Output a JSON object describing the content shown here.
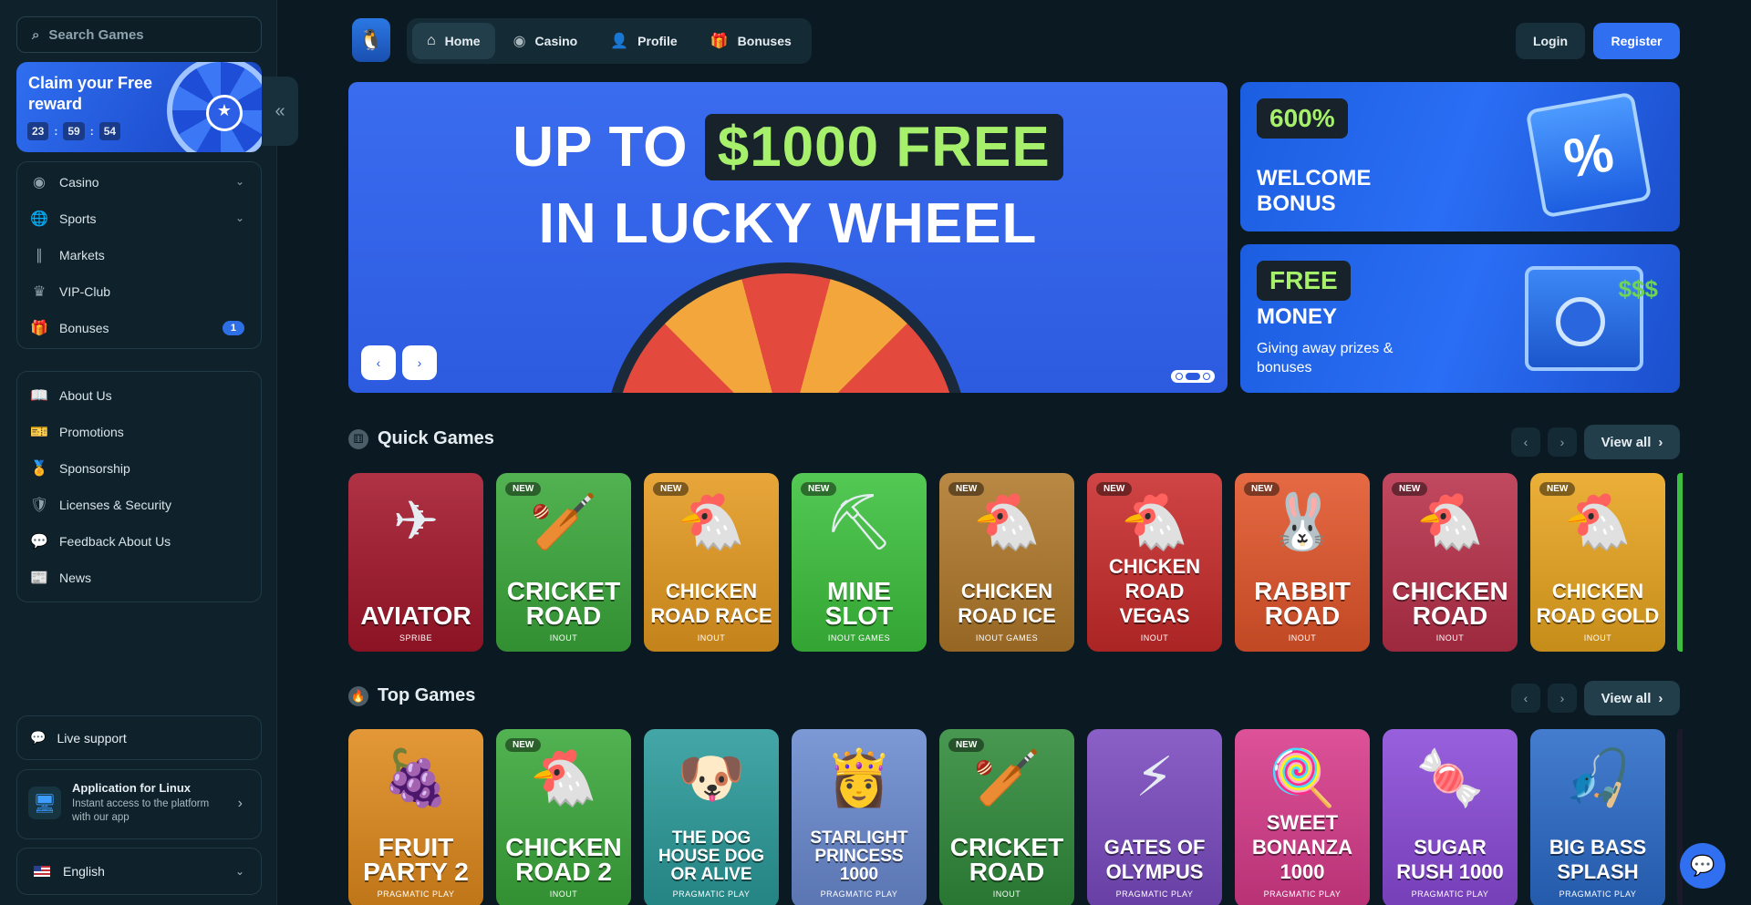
{
  "search": {
    "placeholder": "Search Games"
  },
  "promo": {
    "title": "Claim your Free reward",
    "timer": [
      "23",
      "59",
      "54"
    ]
  },
  "sidebar": {
    "main": [
      {
        "label": "Casino",
        "icon": "casino-chip-icon",
        "chevron": true
      },
      {
        "label": "Sports",
        "icon": "globe-icon",
        "chevron": true
      },
      {
        "label": "Markets",
        "icon": "candles-icon"
      },
      {
        "label": "VIP-Club",
        "icon": "crown-icon"
      },
      {
        "label": "Bonuses",
        "icon": "gift-icon",
        "badge": "1"
      }
    ],
    "info": [
      {
        "label": "About Us",
        "icon": "book-icon"
      },
      {
        "label": "Promotions",
        "icon": "ticket-icon"
      },
      {
        "label": "Sponsorship",
        "icon": "medal-icon"
      },
      {
        "label": "Licenses & Security",
        "icon": "shield-icon"
      },
      {
        "label": "Feedback About Us",
        "icon": "chat-icon"
      },
      {
        "label": "News",
        "icon": "news-icon"
      }
    ],
    "live_support": "Live support",
    "app": {
      "title": "Application for Linux",
      "subtitle": "Instant access to the platform with our app"
    },
    "language": "English"
  },
  "topbar": {
    "tabs": [
      {
        "label": "Home",
        "icon": "home-icon",
        "active": true
      },
      {
        "label": "Casino",
        "icon": "casino-chip-icon"
      },
      {
        "label": "Profile",
        "icon": "user-icon"
      },
      {
        "label": "Bonuses",
        "icon": "gift-icon"
      }
    ],
    "login": "Login",
    "register": "Register"
  },
  "hero": {
    "line1_a": "UP TO",
    "line1_highlight": "$1000 FREE",
    "line2": "IN LUCKY WHEEL",
    "slide_count": 3,
    "active_slide": 1
  },
  "banners": {
    "welcome": {
      "tag": "600%",
      "title": "WELCOME BONUS"
    },
    "money": {
      "tag": "FREE",
      "title": "MONEY",
      "subtitle": "Giving away prizes & bonuses"
    }
  },
  "sections": {
    "quick": {
      "title": "Quick Games",
      "view_all": "View all",
      "games": [
        {
          "name": "AVIATOR",
          "provider": "SPRIBE",
          "new": false,
          "bg": "#a3162a",
          "art": "✈"
        },
        {
          "name": "CRICKET ROAD",
          "provider": "INOUT",
          "new": true,
          "bg": "#3aa83a",
          "art": "🏏"
        },
        {
          "name": "CHICKEN ROAD RACE",
          "provider": "INOUT",
          "new": true,
          "bg": "#e59a1f",
          "art": "🐔"
        },
        {
          "name": "MINE SLOT",
          "provider": "INOUT GAMES",
          "new": true,
          "bg": "#3cc13c",
          "art": "⛏"
        },
        {
          "name": "CHICKEN ROAD ICE",
          "provider": "INOUT GAMES",
          "new": true,
          "bg": "#b0782a",
          "art": "🐔"
        },
        {
          "name": "CHICKEN ROAD VEGAS",
          "provider": "INOUT",
          "new": true,
          "bg": "#c92b2b",
          "art": "🐔"
        },
        {
          "name": "RABBIT ROAD",
          "provider": "INOUT",
          "new": true,
          "bg": "#e2552a",
          "art": "🐰"
        },
        {
          "name": "CHICKEN ROAD",
          "provider": "INOUT",
          "new": true,
          "bg": "#b8304a",
          "art": "🐔"
        },
        {
          "name": "CHICKEN ROAD GOLD",
          "provider": "INOUT",
          "new": true,
          "bg": "#e9a51e",
          "art": "🐔"
        }
      ]
    },
    "top": {
      "title": "Top Games",
      "view_all": "View all",
      "games": [
        {
          "name": "FRUIT PARTY 2",
          "provider": "PRAGMATIC PLAY",
          "new": false,
          "bg": "#e08a1c",
          "art": "🍇"
        },
        {
          "name": "CHICKEN ROAD 2",
          "provider": "INOUT",
          "new": true,
          "bg": "#3aa83a",
          "art": "🐔"
        },
        {
          "name": "THE DOG HOUSE DOG OR ALIVE",
          "provider": "PRAGMATIC PLAY",
          "new": false,
          "bg": "#2a9a9a",
          "art": "🐶"
        },
        {
          "name": "STARLIGHT PRINCESS 1000",
          "provider": "PRAGMATIC PLAY",
          "new": false,
          "bg": "#6a8ad0",
          "art": "👸"
        },
        {
          "name": "CRICKET ROAD",
          "provider": "INOUT",
          "new": true,
          "bg": "#2f8a3a",
          "art": "🏏"
        },
        {
          "name": "GATES OF OLYMPUS",
          "provider": "PRAGMATIC PLAY",
          "new": false,
          "bg": "#7a4ac0",
          "art": "⚡"
        },
        {
          "name": "SWEET BONANZA 1000",
          "provider": "PRAGMATIC PLAY",
          "new": false,
          "bg": "#d83a8a",
          "art": "🍭"
        },
        {
          "name": "SUGAR RUSH 1000",
          "provider": "PRAGMATIC PLAY",
          "new": false,
          "bg": "#8a4ad8",
          "art": "🍬"
        },
        {
          "name": "BIG BASS SPLASH",
          "provider": "PRAGMATIC PLAY",
          "new": false,
          "bg": "#2a6ac8",
          "art": "🎣"
        }
      ]
    }
  },
  "colors": {
    "accent": "#2f6ff0",
    "highlight": "#a6f06b",
    "background": "#0b1a22"
  }
}
